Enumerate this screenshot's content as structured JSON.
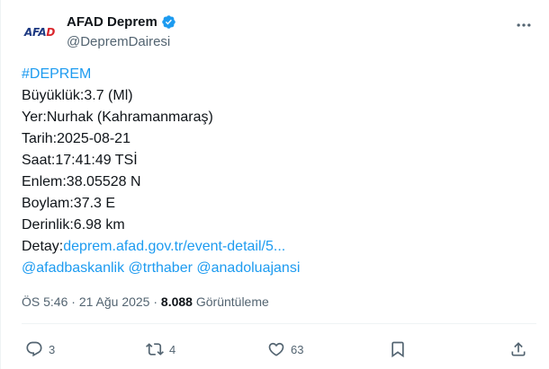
{
  "author": {
    "avatar_text_main": "AFA",
    "avatar_text_accent": "D",
    "name": "AFAD Deprem",
    "handle": "@DepremDairesi",
    "verified_color": "#1d9bf0"
  },
  "post": {
    "hashtag": "#DEPREM",
    "lines": {
      "magnitude": "Büyüklük:3.7 (Ml)",
      "location": "Yer:Nurhak (Kahramanmaraş)",
      "date": "Tarih:2025-08-21",
      "time": "Saat:17:41:49 TSİ",
      "latitude": "Enlem:38.05528 N",
      "longitude": "Boylam:37.3 E",
      "depth": "Derinlik:6.98 km",
      "detail_label": "Detay:",
      "detail_link": "deprem.afad.gov.tr/event-detail/5..."
    },
    "mentions": [
      "@afadbaskanlik",
      "@trthaber",
      "@anadoluajansi"
    ]
  },
  "meta": {
    "time": "ÖS 5:46",
    "separator": " · ",
    "date": "21 Ağu 2025",
    "views_count": "8.088",
    "views_label": " Görüntüleme"
  },
  "actions": {
    "replies": "3",
    "reposts": "4",
    "likes": "63"
  },
  "colors": {
    "link": "#1d9bf0",
    "secondary": "#536471",
    "primary": "#0f1419"
  }
}
